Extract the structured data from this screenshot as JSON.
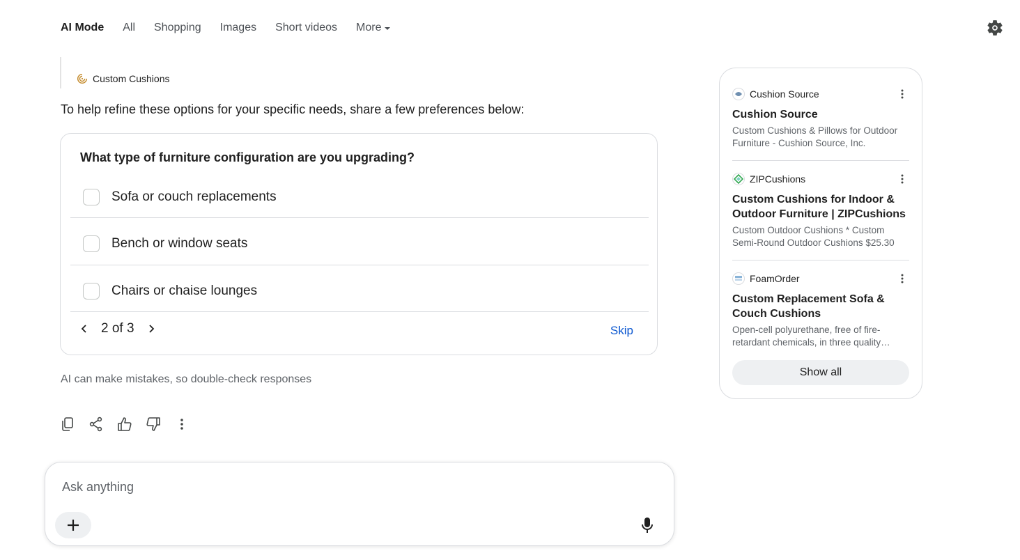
{
  "nav": {
    "tabs": [
      {
        "label": "AI Mode",
        "active": true
      },
      {
        "label": "All"
      },
      {
        "label": "Shopping"
      },
      {
        "label": "Images"
      },
      {
        "label": "Short videos"
      }
    ],
    "more_label": "More",
    "settings_icon": "gear-icon"
  },
  "source_chip": {
    "label": "Custom Cushions",
    "icon": "swirl-logo-icon"
  },
  "intro_text": "To help refine these options for your specific needs, share a few preferences below:",
  "question_card": {
    "question": "What type of furniture configuration are you upgrading?",
    "options": [
      {
        "label": "Sofa or couch replacements",
        "checked": false
      },
      {
        "label": "Bench or window seats",
        "checked": false
      },
      {
        "label": "Chairs or chaise lounges",
        "checked": false
      }
    ],
    "pager": {
      "text": "2 of 3"
    },
    "skip_label": "Skip"
  },
  "disclaimer": "AI can make mistakes, so double-check responses",
  "actions": [
    "copy-icon",
    "share-icon",
    "thumbs-up-icon",
    "thumbs-down-icon",
    "more-vert-icon"
  ],
  "ask": {
    "placeholder": "Ask anything"
  },
  "sources": {
    "items": [
      {
        "site": "Cushion Source",
        "title": "Cushion Source",
        "snippet": "Custom Cushions & Pillows for Outdoor Furniture - Cushion Source, Inc."
      },
      {
        "site": "ZIPCushions",
        "title": "Custom Cushions for Indoor & Outdoor Furniture | ZIPCushions",
        "snippet": "Custom Outdoor Cushions * Custom Semi-Round Outdoor Cushions $25.30"
      },
      {
        "site": "FoamOrder",
        "title": "Custom Replacement Sofa & Couch Cushions",
        "snippet": "Open-cell polyurethane, free of fire-retardant chemicals, in three quality grades"
      }
    ],
    "show_all_label": "Show all"
  },
  "colors": {
    "accent_link": "#0b57d0",
    "border": "#dadce0",
    "chip_bg": "#eef0f2"
  }
}
